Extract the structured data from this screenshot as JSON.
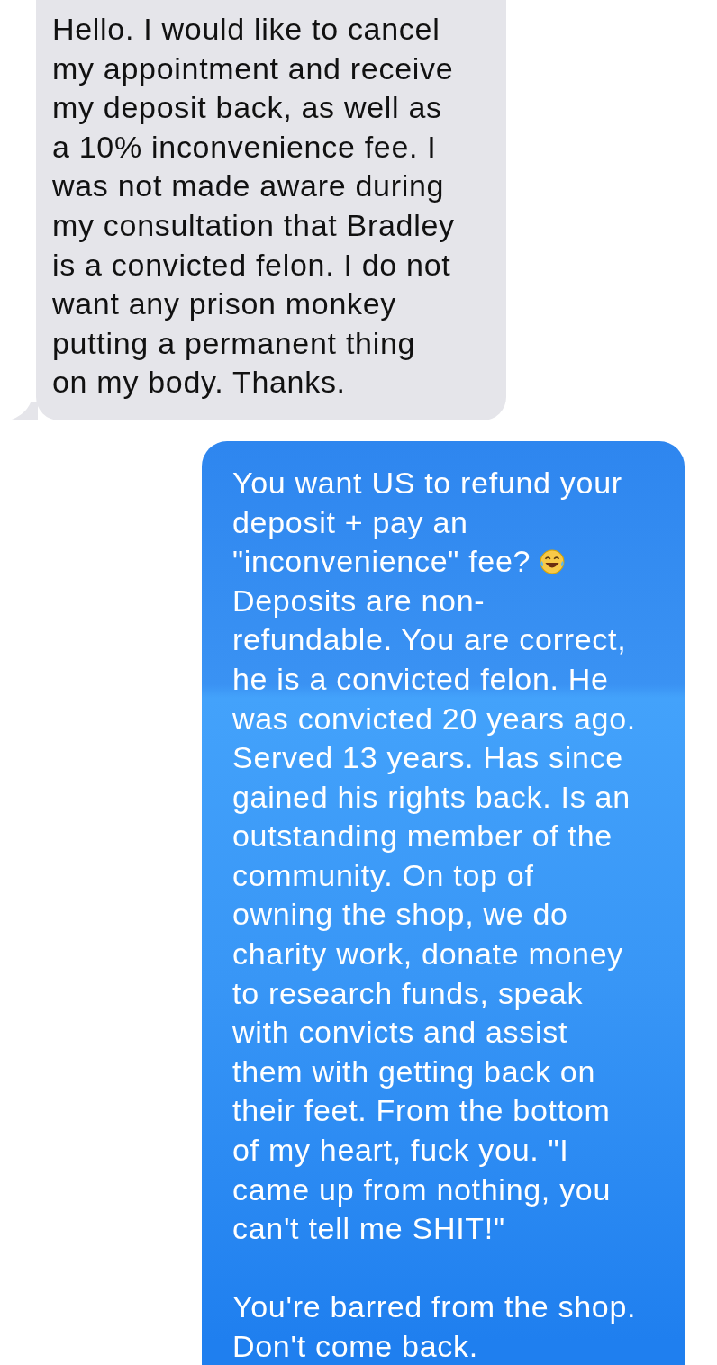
{
  "messages": [
    {
      "kind": "received",
      "paragraphs": [
        [
          [
            {
              "kind": "text",
              "text": "Hello. I would like to cancel\nmy appointment and receive\nmy deposit back, as well as\na 10% inconvenience fee. I\nwas not made aware during\nmy consultation that Bradley\nis a convicted felon. I do not\nwant any prison monkey\nputting a permanent thing\non my body. Thanks."
            }
          ]
        ]
      ]
    },
    {
      "kind": "sent",
      "paragraphs": [
        [
          [
            {
              "kind": "text",
              "text": "You want US to refund your\ndeposit + pay an"
            }
          ],
          [
            {
              "kind": "text",
              "text": "\"inconvenience\" fee?"
            },
            {
              "kind": "emoji"
            }
          ],
          [
            {
              "kind": "text",
              "text": "Deposits are non-\nrefundable. You are correct,\nhe is a convicted felon. He\nwas convicted 20 years ago.\nServed 13 years. Has since\ngained his rights back. Is an\noutstanding member of the\ncommunity. On top of\nowning the shop, we do\ncharity work, donate money\nto research funds, speak\nwith convicts and assist\nthem with getting back on\ntheir feet. From the bottom\nof my heart, fuck you. \"I\ncame up from nothing, you\ncan't tell me SHIT!\""
            }
          ]
        ],
        [
          [
            {
              "kind": "text",
              "text": "You're barred from the shop.\nDon't come back."
            }
          ]
        ]
      ]
    }
  ]
}
